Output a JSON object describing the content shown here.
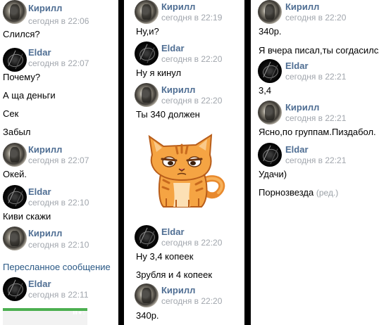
{
  "chat": {
    "columns": [
      {
        "entries": [
          {
            "kind": "header",
            "author": "Кирилл",
            "time": "сегодня в 22:06",
            "avatar": "kirill"
          },
          {
            "kind": "message",
            "text": "Слился?"
          },
          {
            "kind": "header",
            "author": "Eldar",
            "time": "сегодня в 22:07",
            "avatar": "eldar"
          },
          {
            "kind": "message",
            "text": "Почему?"
          },
          {
            "kind": "message",
            "text": "А ща деньги"
          },
          {
            "kind": "message",
            "text": "Сек"
          },
          {
            "kind": "message",
            "text": "Забыл"
          },
          {
            "kind": "header",
            "author": "Кирилл",
            "time": "сегодня в 22:07",
            "avatar": "kirill"
          },
          {
            "kind": "message",
            "text": "Окей."
          },
          {
            "kind": "header",
            "author": "Eldar",
            "time": "сегодня в 22:10",
            "avatar": "eldar"
          },
          {
            "kind": "message",
            "text": "Киви скажи"
          },
          {
            "kind": "header",
            "author": "Кирилл",
            "time": "сегодня в 22:10",
            "avatar": "kirill"
          },
          {
            "kind": "forwarded",
            "text": "Пересланное сообщение"
          },
          {
            "kind": "header",
            "author": "Eldar",
            "time": "сегодня в 22:11",
            "avatar": "eldar"
          }
        ]
      },
      {
        "entries": [
          {
            "kind": "header",
            "author": "Кирилл",
            "time": "сегодня в 22:19",
            "avatar": "kirill"
          },
          {
            "kind": "message",
            "text": "Ну,и?"
          },
          {
            "kind": "header",
            "author": "Eldar",
            "time": "сегодня в 22:20",
            "avatar": "eldar"
          },
          {
            "kind": "message",
            "text": "Ну я кинул"
          },
          {
            "kind": "header",
            "author": "Кирилл",
            "time": "сегодня в 22:20",
            "avatar": "kirill"
          },
          {
            "kind": "message",
            "text": "Ты 340 должен"
          },
          {
            "kind": "sticker",
            "icon": "ginger-cat-sticker-icon"
          },
          {
            "kind": "header",
            "author": "Eldar",
            "time": "сегодня в 22:20",
            "avatar": "eldar"
          },
          {
            "kind": "message",
            "text": "Ну 3,4 копеек"
          },
          {
            "kind": "message",
            "text": "3рубля и 4 копеек"
          },
          {
            "kind": "header",
            "author": "Кирилл",
            "time": "сегодня в 22:20",
            "avatar": "kirill"
          },
          {
            "kind": "message",
            "text": "340р."
          }
        ]
      },
      {
        "entries": [
          {
            "kind": "header",
            "author": "Кирилл",
            "time": "сегодня в 22:20",
            "avatar": "kirill"
          },
          {
            "kind": "message",
            "text": "340р."
          },
          {
            "kind": "message",
            "text": "Я вчера писал,ты согдасился"
          },
          {
            "kind": "header",
            "author": "Eldar",
            "time": "сегодня в 22:21",
            "avatar": "eldar"
          },
          {
            "kind": "message",
            "text": "3,4"
          },
          {
            "kind": "header",
            "author": "Кирилл",
            "time": "сегодня в 22:21",
            "avatar": "kirill"
          },
          {
            "kind": "message",
            "text": "Ясно,по группам.Пиздабол."
          },
          {
            "kind": "header",
            "author": "Eldar",
            "time": "сегодня в 22:21",
            "avatar": "eldar"
          },
          {
            "kind": "message",
            "text": "Удачи)"
          },
          {
            "kind": "message",
            "text": "Порнозвезда",
            "edited": "(ред.)"
          }
        ]
      }
    ],
    "colors": {
      "author": "#4f6e93",
      "time": "#a1a6ad",
      "link": "#2a5885",
      "divider": "#000000"
    }
  }
}
